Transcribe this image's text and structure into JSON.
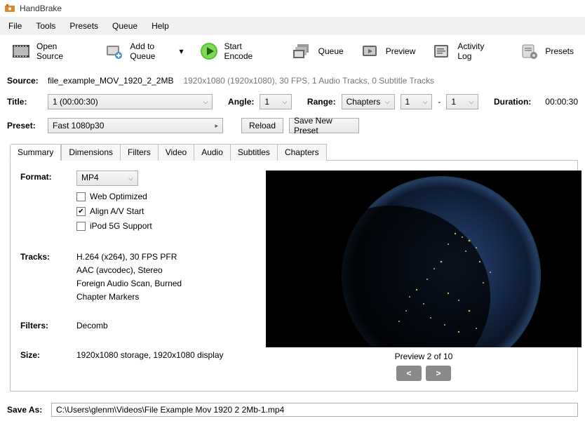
{
  "app": {
    "title": "HandBrake"
  },
  "menu": {
    "file": "File",
    "tools": "Tools",
    "presets": "Presets",
    "queue": "Queue",
    "help": "Help"
  },
  "toolbar": {
    "open_source": "Open Source",
    "add_to_queue": "Add to Queue",
    "start_encode": "Start Encode",
    "queue": "Queue",
    "preview": "Preview",
    "activity_log": "Activity Log",
    "presets": "Presets"
  },
  "source": {
    "label": "Source:",
    "filename": "file_example_MOV_1920_2_2MB",
    "info": "1920x1080 (1920x1080), 30 FPS, 1 Audio Tracks, 0 Subtitle Tracks"
  },
  "title_row": {
    "title_label": "Title:",
    "title_value": "1  (00:00:30)",
    "angle_label": "Angle:",
    "angle_value": "1",
    "range_label": "Range:",
    "range_type": "Chapters",
    "range_start": "1",
    "range_dash": "-",
    "range_end": "1",
    "duration_label": "Duration:",
    "duration_value": "00:00:30"
  },
  "preset_row": {
    "label": "Preset:",
    "value": "Fast 1080p30",
    "reload": "Reload",
    "save_new": "Save New Preset"
  },
  "tabs": {
    "summary": "Summary",
    "dimensions": "Dimensions",
    "filters": "Filters",
    "video": "Video",
    "audio": "Audio",
    "subtitles": "Subtitles",
    "chapters": "Chapters"
  },
  "summary": {
    "format_label": "Format:",
    "format_value": "MP4",
    "web_optimized": "Web Optimized",
    "align_av": "Align A/V Start",
    "ipod": "iPod 5G Support",
    "tracks_label": "Tracks:",
    "tracks_line1": "H.264 (x264), 30 FPS PFR",
    "tracks_line2": "AAC (avcodec), Stereo",
    "tracks_line3": "Foreign Audio Scan, Burned",
    "tracks_line4": "Chapter Markers",
    "filters_label": "Filters:",
    "filters_value": "Decomb",
    "size_label": "Size:",
    "size_value": "1920x1080 storage, 1920x1080 display"
  },
  "preview": {
    "caption": "Preview 2 of 10",
    "prev": "<",
    "next": ">"
  },
  "saveas": {
    "label": "Save As:",
    "path": "C:\\Users\\glenm\\Videos\\File Example Mov 1920 2 2Mb-1.mp4"
  }
}
